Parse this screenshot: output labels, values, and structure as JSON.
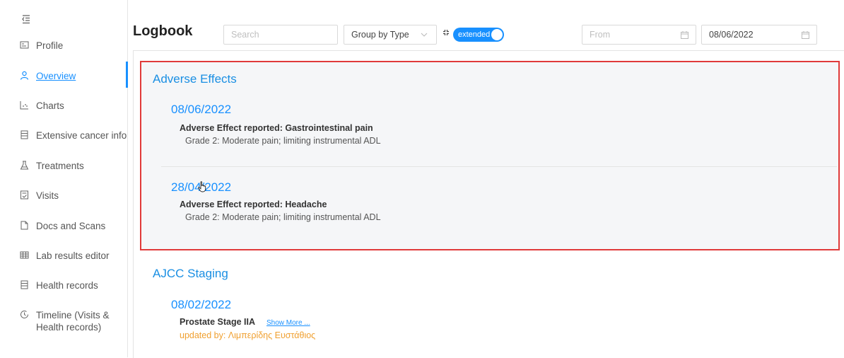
{
  "sidebar": {
    "items": [
      {
        "label": "Profile",
        "icon": "profile-icon"
      },
      {
        "label": "Overview",
        "icon": "user-icon",
        "active": true
      },
      {
        "label": "Charts",
        "icon": "chart-icon"
      },
      {
        "label": "Extensive cancer info",
        "icon": "database-icon"
      },
      {
        "label": "Treatments",
        "icon": "flask-icon"
      },
      {
        "label": "Visits",
        "icon": "visits-icon"
      },
      {
        "label": "Docs and Scans",
        "icon": "file-icon"
      },
      {
        "label": "Lab results editor",
        "icon": "table-icon"
      },
      {
        "label": "Health records",
        "icon": "records-icon"
      },
      {
        "label": "Timeline (Visits & Health records)",
        "label_line1": "Timeline (Visits &",
        "label_line2": "Health records)",
        "icon": "clock-icon"
      }
    ]
  },
  "header": {
    "title": "Logbook",
    "search_placeholder": "Search",
    "group_by": "Group by Type",
    "toggle_label": "extended",
    "from_placeholder": "From",
    "to_date": "08/06/2022"
  },
  "groups": {
    "adverse": {
      "title": "Adverse Effects",
      "entries": [
        {
          "date": "08/06/2022",
          "head": "Adverse Effect reported: Gastrointestinal pain",
          "sub": "Grade 2: Moderate pain; limiting instrumental ADL"
        },
        {
          "date": "28/04/2022",
          "head": "Adverse Effect reported: Headache",
          "sub": "Grade 2: Moderate pain; limiting instrumental ADL"
        }
      ]
    },
    "ajcc": {
      "title": "AJCC Staging",
      "entries": [
        {
          "date": "08/02/2022",
          "head": "Prostate Stage IIA",
          "show_more": "Show More ...",
          "updated_by": "updated by: Λιμπερίδης Ευστάθιος"
        }
      ]
    }
  },
  "colors": {
    "accent": "#1890ff",
    "highlight_border": "#e03a3a",
    "updated": "#f0a030"
  }
}
